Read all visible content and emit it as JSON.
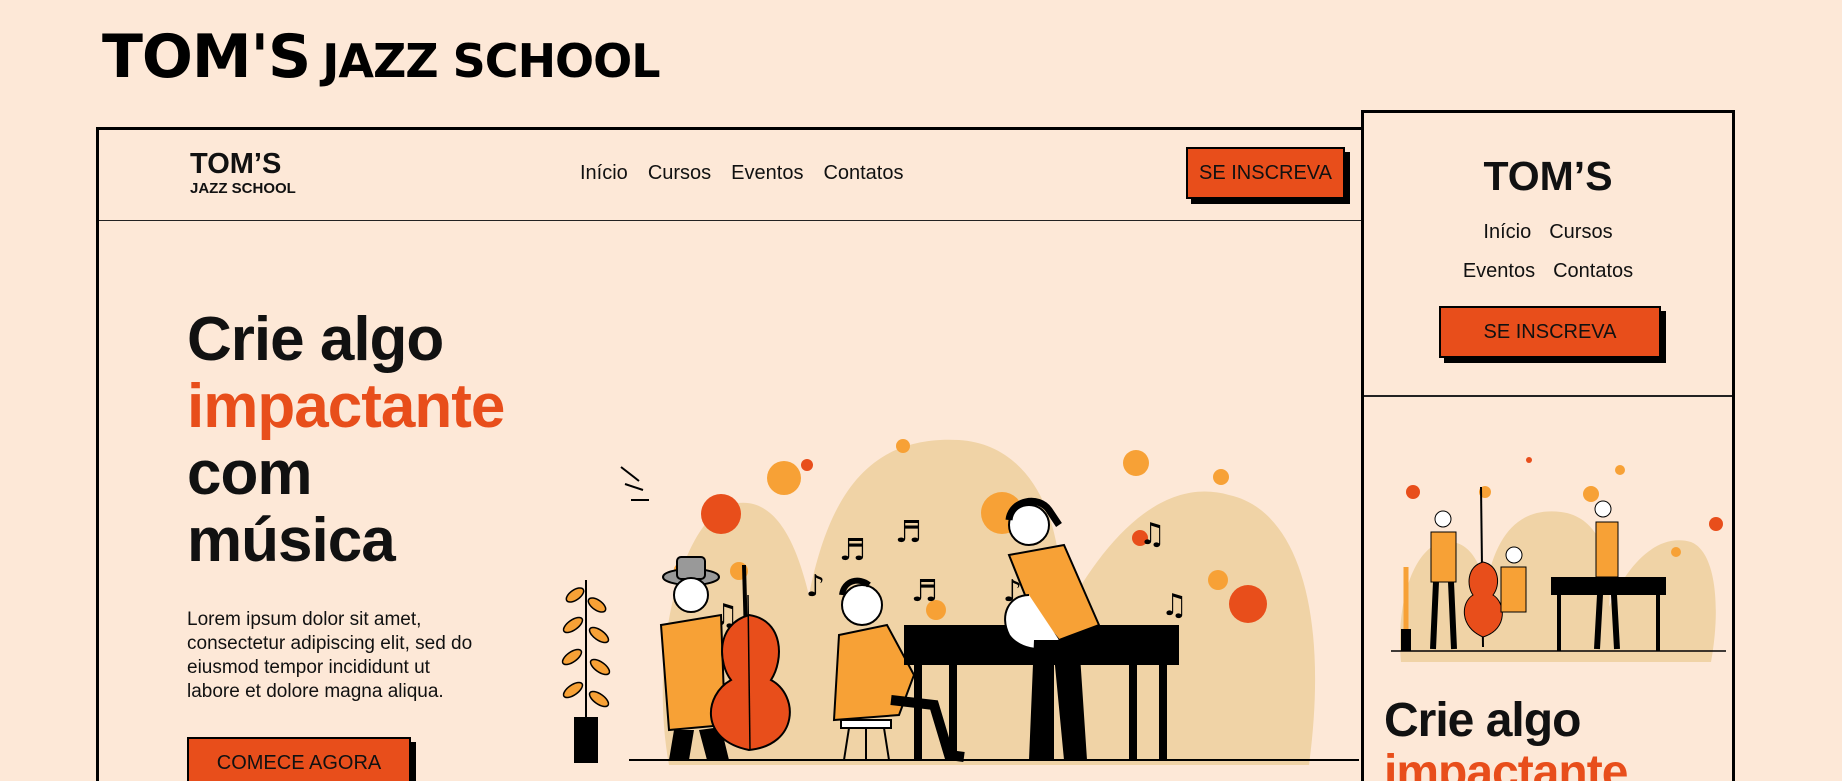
{
  "page": {
    "title_big": "TOM'S",
    "title_small": "JAZZ SCHOOL"
  },
  "desktop": {
    "logo_line1": "TOM’S",
    "logo_line2": "JAZZ SCHOOL",
    "nav": [
      "Início",
      "Cursos",
      "Eventos",
      "Contatos"
    ],
    "cta_label": "SE INSCREVA",
    "hero_title_line1": "Crie algo",
    "hero_title_accent": "impactante",
    "hero_title_line3": "com",
    "hero_title_line4": "música",
    "hero_text": "Lorem ipsum dolor sit amet, consectetur adipiscing elit, sed do eiusmod tempor incididunt ut labore et dolore magna aliqua.",
    "secondary_cta_label": "COMECE AGORA"
  },
  "mobile": {
    "logo": "TOM’S",
    "nav_row1": [
      "Início",
      "Cursos"
    ],
    "nav_row2": [
      "Eventos",
      "Contatos"
    ],
    "cta_label": "SE INSCREVA",
    "hero_title_line1": "Crie algo",
    "hero_title_accent": "impactante"
  },
  "colors": {
    "background": "#fde8d7",
    "accent": "#e84e1b",
    "orange": "#f7a136",
    "sand": "#f0d3a6",
    "ink": "#000000"
  }
}
